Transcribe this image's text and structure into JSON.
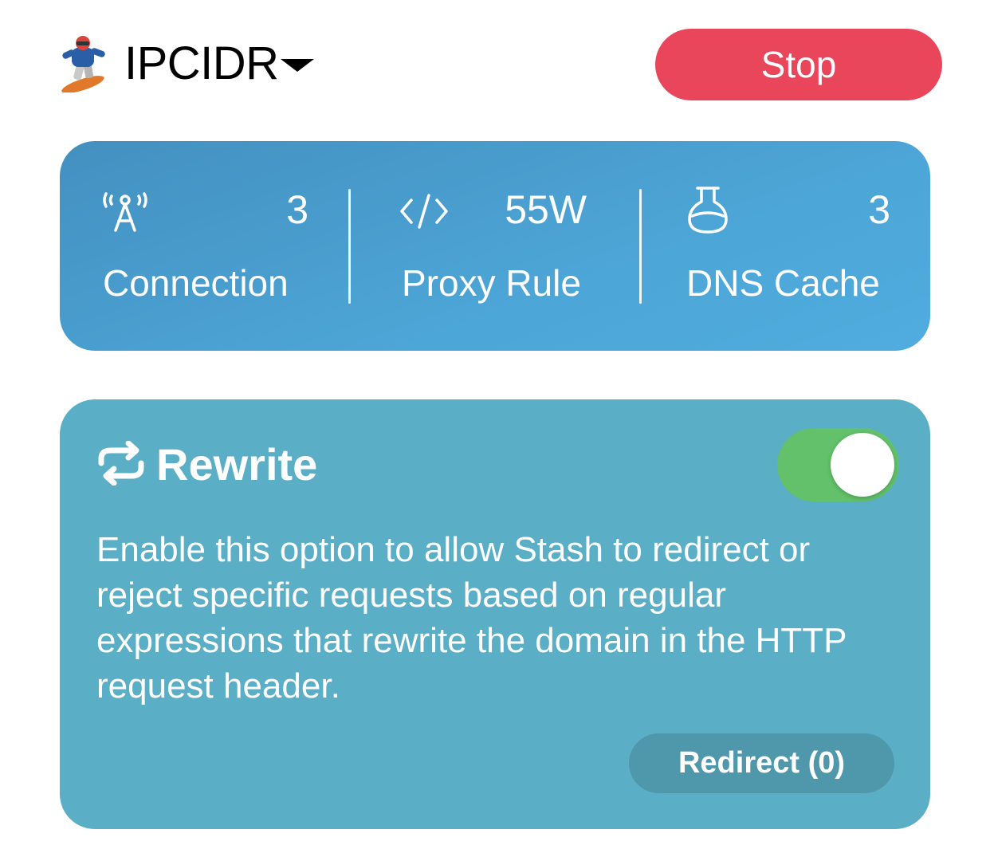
{
  "header": {
    "profile_name": "IPCIDR",
    "stop_label": "Stop"
  },
  "stats": [
    {
      "icon": "antenna-icon",
      "value": "3",
      "label": "Connection"
    },
    {
      "icon": "code-icon",
      "value": "55W",
      "label": "Proxy Rule"
    },
    {
      "icon": "flask-icon",
      "value": "3",
      "label": "DNS Cache"
    }
  ],
  "rewrite": {
    "title": "Rewrite",
    "enabled": true,
    "description": "Enable this option to allow Stash to redirect or reject specific requests based on regular expressions that rewrite the domain in the HTTP request header.",
    "redirect_label": "Redirect (0)"
  },
  "colors": {
    "stop_red": "#e9455b",
    "stats_blue": "#4ca5d6",
    "rewrite_teal": "#5aaec6",
    "toggle_green": "#62c16a"
  }
}
